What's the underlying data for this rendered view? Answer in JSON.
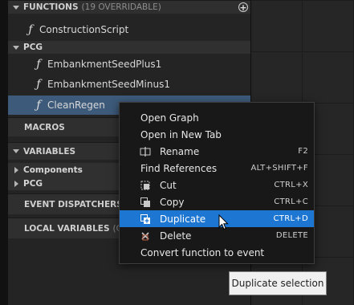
{
  "functions": {
    "header_label": "FUNCTIONS",
    "header_count": "(19 OVERRIDABLE)",
    "construction_script": "ConstructionScript",
    "pcg_header": "PCG",
    "items": [
      {
        "label": "EmbankmentSeedPlus1"
      },
      {
        "label": "EmbankmentSeedMinus1"
      },
      {
        "label": "CleanRegen"
      }
    ]
  },
  "macros": {
    "header_label": "MACROS"
  },
  "variables": {
    "header_label": "VARIABLES",
    "groups": [
      "Components",
      "PCG"
    ]
  },
  "event_dispatchers": {
    "header_label": "EVENT DISPATCHERS"
  },
  "local_variables": {
    "header_label": "LOCAL VARIABLES",
    "header_suffix": "(CLE"
  },
  "context_menu": {
    "items": [
      {
        "label": "Open Graph",
        "shortcut": "",
        "icon": ""
      },
      {
        "label": "Open in New Tab",
        "shortcut": "",
        "icon": ""
      },
      {
        "label": "Rename",
        "shortcut": "F2",
        "icon": "rename-icon"
      },
      {
        "label": "Find References",
        "shortcut": "ALT+SHIFT+F",
        "icon": ""
      },
      {
        "label": "Cut",
        "shortcut": "CTRL+X",
        "icon": "cut-icon"
      },
      {
        "label": "Copy",
        "shortcut": "CTRL+C",
        "icon": "copy-icon"
      },
      {
        "label": "Duplicate",
        "shortcut": "CTRL+D",
        "icon": "duplicate-icon"
      },
      {
        "label": "Delete",
        "shortcut": "DELETE",
        "icon": "delete-icon"
      },
      {
        "label": "Convert function to event",
        "shortcut": "",
        "icon": ""
      }
    ]
  },
  "tooltip": {
    "text": "Duplicate selection"
  },
  "colors": {
    "highlight": "#1d76d2",
    "selected_row": "#3d5a7a"
  }
}
